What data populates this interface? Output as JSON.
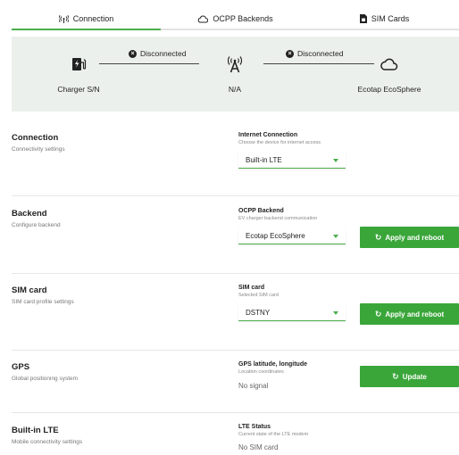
{
  "tabs": [
    {
      "label": "Connection",
      "icon": "signal-icon",
      "active": true
    },
    {
      "label": "OCPP Backends",
      "icon": "cloud-icon",
      "active": false
    },
    {
      "label": "SIM Cards",
      "icon": "sim-card-icon",
      "active": false
    }
  ],
  "status": {
    "charger_label": "Charger S/N",
    "antenna_label": "N/A",
    "cloud_label": "Ecotap EcoSphere",
    "link1_status": "Disconnected",
    "link2_status": "Disconnected"
  },
  "connection": {
    "title": "Connection",
    "subtitle": "Connectivity settings",
    "field_label": "Internet Connection",
    "field_help": "Choose the device for internet access",
    "select_value": "Built-in LTE"
  },
  "backend": {
    "title": "Backend",
    "subtitle": "Configure backend",
    "field_label": "OCPP Backend",
    "field_help": "EV charger backend communication",
    "select_value": "Ecotap EcoSphere",
    "button_label": "Apply and reboot"
  },
  "simcard": {
    "title": "SIM card",
    "subtitle": "SIM card profile settings",
    "field_label": "SIM card",
    "field_help": "Selected SIM card",
    "select_value": "DSTNY",
    "button_label": "Apply and reboot"
  },
  "gps": {
    "title": "GPS",
    "subtitle": "Global positioning system",
    "field_label": "GPS latitude, longitude",
    "field_help": "Location coordinates",
    "value": "No signal",
    "button_label": "Update"
  },
  "lte": {
    "title": "Built-in LTE",
    "subtitle": "Mobile connectivity settings",
    "field_label": "LTE Status",
    "field_help": "Current state of the LTE modem",
    "value": "No SIM card"
  },
  "colors": {
    "accent": "#3aa63a",
    "panel_bg": "#ecf0ec"
  }
}
